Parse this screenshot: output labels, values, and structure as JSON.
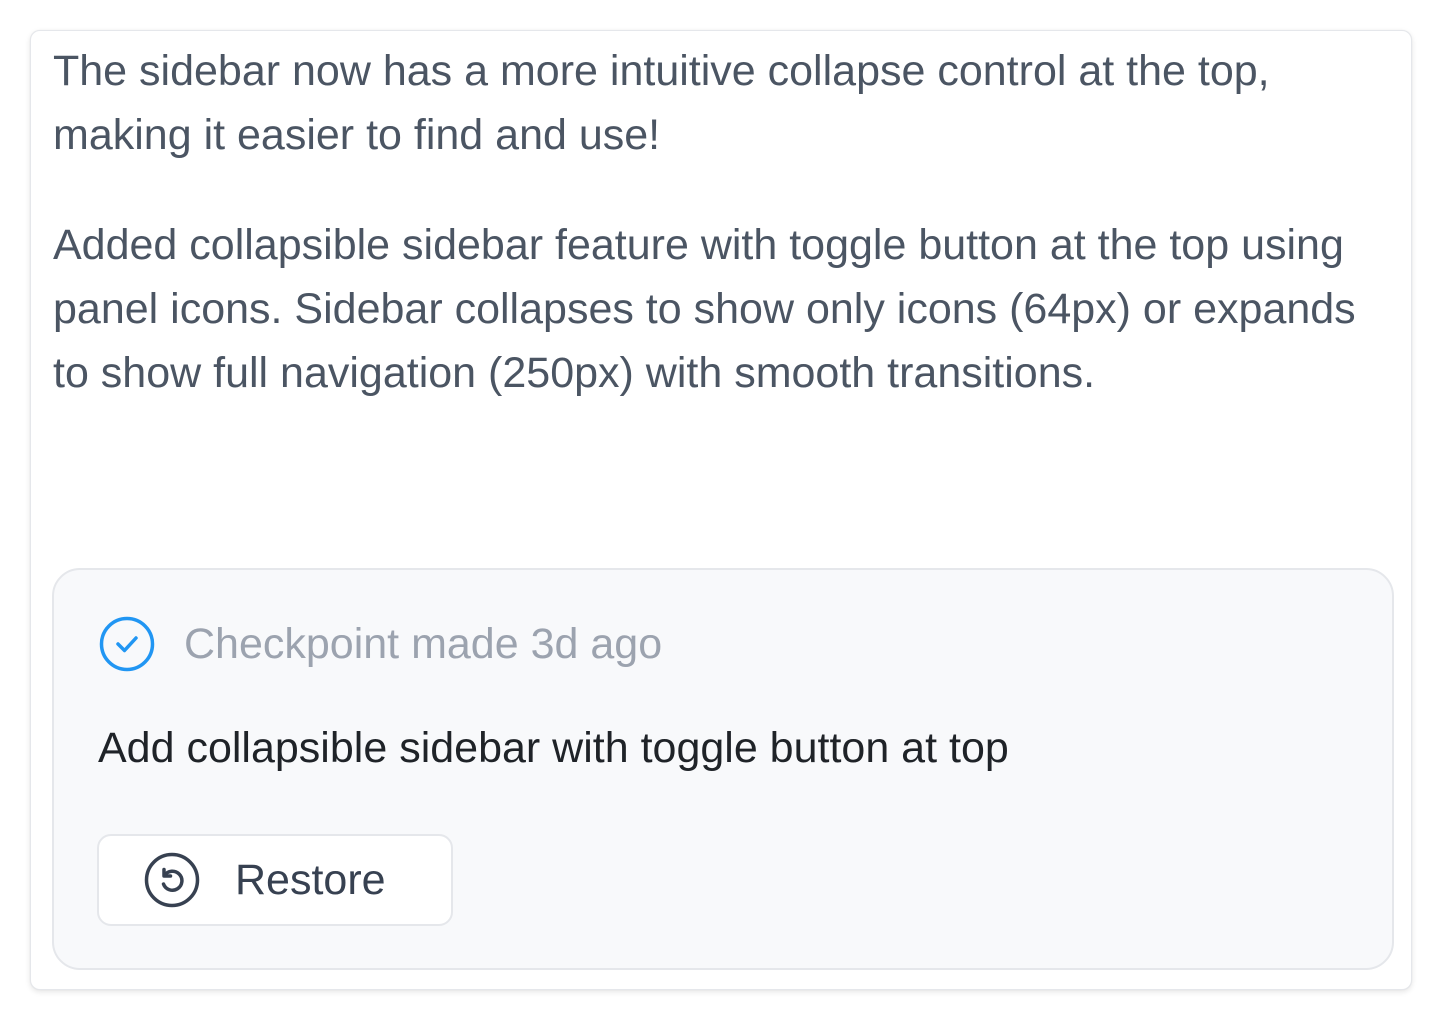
{
  "message": {
    "paragraphs": [
      "The sidebar now has a more intuitive collapse control at the top, making it easier to find and use!",
      "Added collapsible sidebar feature with toggle button at the top using panel icons. Sidebar collapses to show only icons (64px) or expands to show full navigation (250px) with smooth transitions."
    ]
  },
  "checkpoint": {
    "status_icon": "check-circle-icon",
    "status_text": "Checkpoint made 3d ago",
    "title": "Add collapsible sidebar with toggle button at top",
    "restore_icon": "restore-icon",
    "restore_label": "Restore"
  },
  "colors": {
    "accent": "#2196f3",
    "text_muted": "#9ca3af",
    "text_body": "#4b5563"
  }
}
